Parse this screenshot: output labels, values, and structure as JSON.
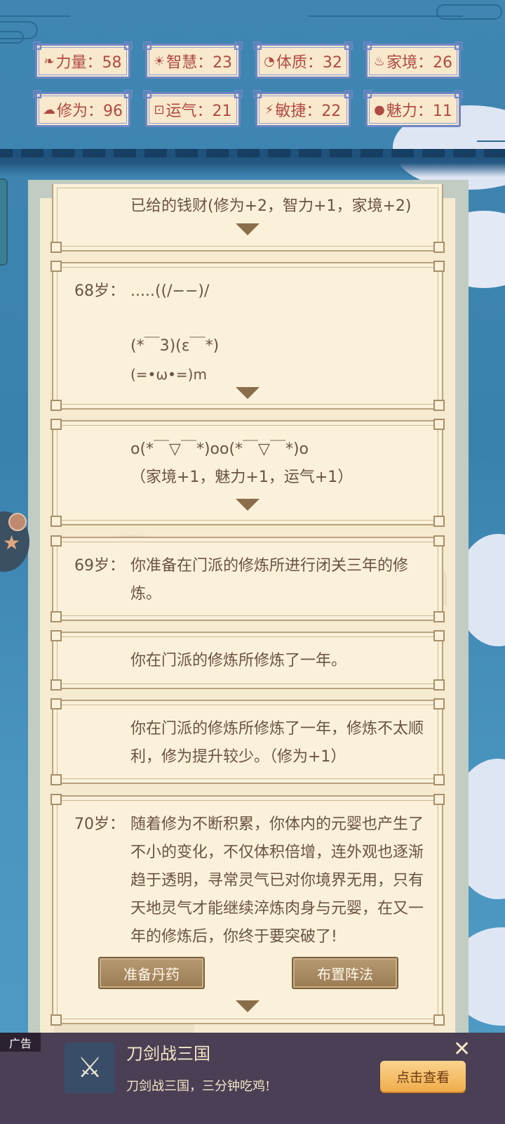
{
  "stats": [
    {
      "icon": "strength-icon",
      "glyph": "❧",
      "label": "力量：58"
    },
    {
      "icon": "wisdom-icon",
      "glyph": "☀",
      "label": "智慧：23"
    },
    {
      "icon": "constitution-icon",
      "glyph": "◔",
      "label": "体质：32"
    },
    {
      "icon": "family-icon",
      "glyph": "♨",
      "label": "家境：26"
    },
    {
      "icon": "cultivation-icon",
      "glyph": "☁",
      "label": "修为：96"
    },
    {
      "icon": "luck-icon",
      "glyph": "⊡",
      "label": "运气：21"
    },
    {
      "icon": "agility-icon",
      "glyph": "⚡",
      "label": "敏捷：22"
    },
    {
      "icon": "charm-icon",
      "glyph": "●",
      "label": "魅力：11"
    }
  ],
  "log": {
    "partial_top": "已给的钱财(修为+2，智力+1，家境+2)",
    "entry68_age": "68岁：",
    "entry68_line1": ".....((/−−)/",
    "entry68_line2": "(*￣3)(ε￣*)",
    "entry68_line3": "(=•ω•=)m",
    "entry68b_line1": "o(*￣▽￣*)oo(*￣▽￣*)o",
    "entry68b_line2": "（家境+1，魅力+1，运气+1）",
    "entry69_age": "69岁：",
    "entry69_text": "你准备在门派的修炼所进行闭关三年的修炼。",
    "entry69b_text": "你在门派的修炼所修炼了一年。",
    "entry69c_text": "你在门派的修炼所修炼了一年，修炼不太顺利，修为提升较少。（修为+1）",
    "entry70_age": "70岁：",
    "entry70_text": "随着修为不断积累，你体内的元婴也产生了不小的变化，不仅体积倍增，连外观也逐渐趋于透明，寻常灵气已对你境界无用，只有天地灵气才能继续淬炼肉身与元婴，在又一年的修炼后，你终于要突破了!",
    "btn_pills": "准备丹药",
    "btn_array": "布置阵法"
  },
  "ad": {
    "tag": "广告",
    "title": "刀剑战三国",
    "subtitle": "刀剑战三国，三分钟吃鸡!",
    "cta": "点击查看",
    "close": "✕"
  }
}
